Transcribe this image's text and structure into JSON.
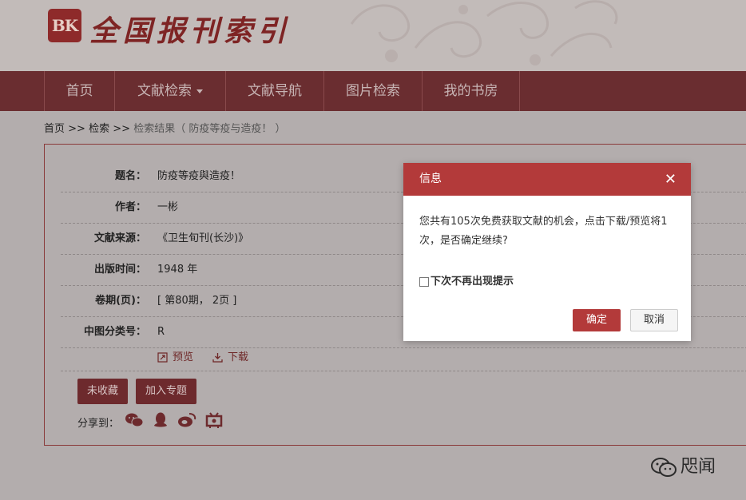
{
  "logo": {
    "seal": "BK",
    "title": "全国报刊索引"
  },
  "nav": {
    "items": [
      {
        "label": "首页"
      },
      {
        "label": "文献检索"
      },
      {
        "label": "文献导航"
      },
      {
        "label": "图片检索"
      },
      {
        "label": "我的书房"
      }
    ]
  },
  "breadcrumb": {
    "home": "首页",
    "sep1": ">>",
    "search": "检索",
    "sep2": ">>",
    "current": "检索结果（ 防疫等疫与造疫！ ）"
  },
  "record": {
    "fields": [
      {
        "label": "题名：",
        "value": "防疫等疫與造疫！"
      },
      {
        "label": "作者：",
        "value": "一彬"
      },
      {
        "label": "文献来源：",
        "value": "《卫生旬刊(长沙)》"
      },
      {
        "label": "出版时间：",
        "value": "1948 年"
      },
      {
        "label": "卷期(页)：",
        "value": "[ 第80期， 2页 ]"
      },
      {
        "label": "中图分类号：",
        "value": "R"
      }
    ],
    "preview": "预览",
    "download": "下载",
    "favorite": "未收藏",
    "add_topic": "加入专题",
    "share_label": "分享到："
  },
  "dialog": {
    "title": "信息",
    "close": "✕",
    "message": "您共有105次免费获取文献的机会，点击下载/预览将1次，是否确定继续?",
    "checkbox_label": "下次不再出现提示",
    "ok": "确定",
    "cancel": "取消"
  },
  "watermark": {
    "text": "咫闻"
  },
  "colors": {
    "nav_bg": "#6a2d30",
    "accent": "#b33a3a",
    "button": "#6d2a2d"
  }
}
